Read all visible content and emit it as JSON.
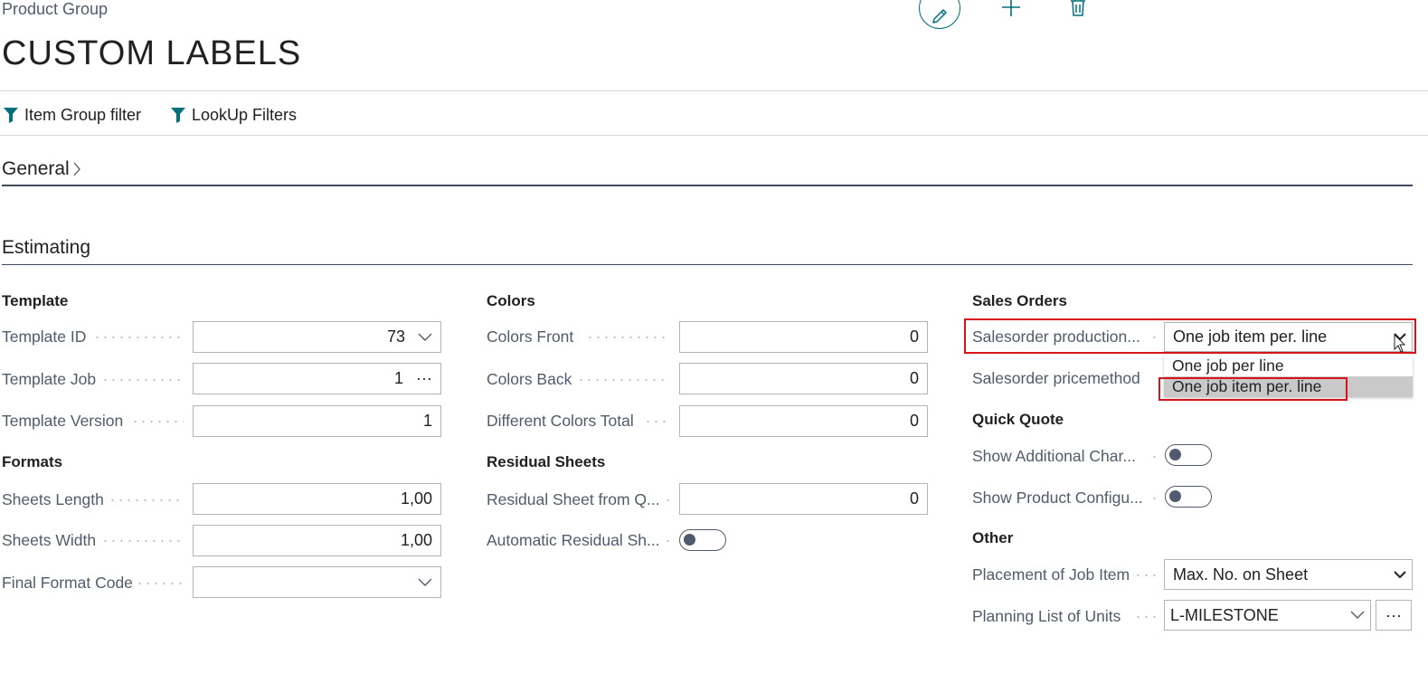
{
  "page": {
    "caption": "Product Group",
    "title": "CUSTOM LABELS"
  },
  "header_actions": {
    "edit_icon": "pencil-icon",
    "add_icon": "plus-icon",
    "delete_icon": "trash-icon"
  },
  "actions": [
    {
      "label": "Item Group filter",
      "icon": "filter-icon"
    },
    {
      "label": "LookUp Filters",
      "icon": "filter-icon"
    }
  ],
  "sections": {
    "general": {
      "title": "General",
      "icon": "chevron-right-icon"
    },
    "estimating": {
      "title": "Estimating"
    }
  },
  "col1": {
    "template_group": "Template",
    "template_id": {
      "label": "Template ID",
      "value": "73"
    },
    "template_job": {
      "label": "Template Job",
      "value": "1",
      "more": "···"
    },
    "template_version": {
      "label": "Template Version",
      "value": "1"
    },
    "formats_group": "Formats",
    "sheets_length": {
      "label": "Sheets Length",
      "value": "1,00"
    },
    "sheets_width": {
      "label": "Sheets Width",
      "value": "1,00"
    },
    "final_format_code": {
      "label": "Final Format Code",
      "value": ""
    }
  },
  "col2": {
    "colors_group": "Colors",
    "colors_front": {
      "label": "Colors Front",
      "value": "0"
    },
    "colors_back": {
      "label": "Colors Back",
      "value": "0"
    },
    "different_colors_total": {
      "label": "Different Colors Total",
      "value": "0"
    },
    "residual_group": "Residual Sheets",
    "residual_sheet_from": {
      "label": "Residual Sheet from Q...",
      "value": "0"
    },
    "automatic_residual": {
      "label": "Automatic Residual Sh...",
      "on": false
    }
  },
  "col3": {
    "sales_orders_group": "Sales Orders",
    "salesorder_production": {
      "label": "Salesorder production...",
      "value": "One job item per. line",
      "options": [
        "One job per line",
        "One job item per. line"
      ],
      "highlighted_option": "One job item per. line"
    },
    "salesorder_pricemethod": {
      "label": "Salesorder pricemethod"
    },
    "quick_quote_group": "Quick Quote",
    "show_additional_charges": {
      "label": "Show Additional Char...",
      "on": false
    },
    "show_product_configurator": {
      "label": "Show Product Configu...",
      "on": false
    },
    "other_group": "Other",
    "placement_of_job_item": {
      "label": "Placement of Job Item",
      "value": "Max. No. on Sheet"
    },
    "planning_list_of_units": {
      "label": "Planning List of Units",
      "value": "L-MILESTONE",
      "more": "···"
    }
  },
  "colors": {
    "accent": "#00707a",
    "highlight_border": "#d7141a",
    "label_text": "#505c6d"
  }
}
